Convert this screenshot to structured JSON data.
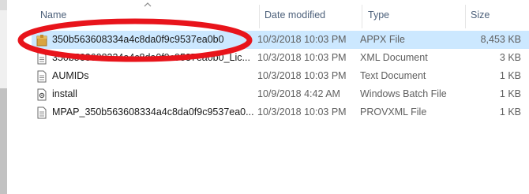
{
  "columns": {
    "name": "Name",
    "date": "Date modified",
    "type": "Type",
    "size": "Size"
  },
  "files": [
    {
      "name": "350b563608334a4c8da0f9c9537ea0b0",
      "date": "10/3/2018 10:03 PM",
      "type": "APPX File",
      "size": "8,453 KB",
      "icon": "package-icon",
      "selected": true
    },
    {
      "name": "350b563608334a4c8da0f9c9537ea0b0_Lic...",
      "date": "10/3/2018 10:03 PM",
      "type": "XML Document",
      "size": "3 KB",
      "icon": "document-icon",
      "selected": false
    },
    {
      "name": "AUMIDs",
      "date": "10/3/2018 10:03 PM",
      "type": "Text Document",
      "size": "1 KB",
      "icon": "document-icon",
      "selected": false
    },
    {
      "name": "install",
      "date": "10/9/2018 4:42 AM",
      "type": "Windows Batch File",
      "size": "1 KB",
      "icon": "batch-file-icon",
      "selected": false
    },
    {
      "name": "MPAP_350b563608334a4c8da0f9c9537ea0...",
      "date": "10/3/2018 10:03 PM",
      "type": "PROVXML File",
      "size": "1 KB",
      "icon": "document-icon",
      "selected": false
    }
  ],
  "colors": {
    "selection": "#cce8ff",
    "header_text": "#4c607a",
    "annotation": "#e8141b"
  }
}
